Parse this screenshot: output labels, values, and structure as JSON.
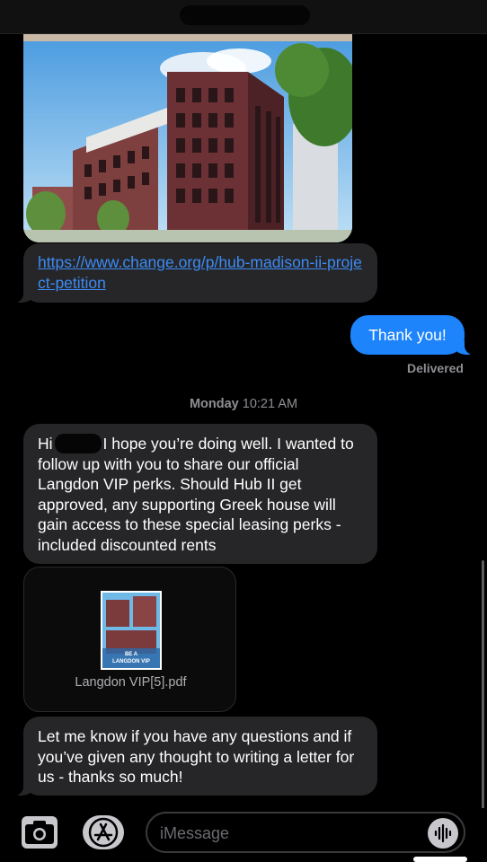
{
  "thread": {
    "messages": [
      {
        "type": "image",
        "sender": "contact"
      },
      {
        "type": "link",
        "sender": "contact",
        "text": "https://www.change.org/p/hub-madison-ii-project-petition"
      },
      {
        "type": "text",
        "sender": "me",
        "text": "Thank you!",
        "status": "Delivered"
      }
    ],
    "timestamp": {
      "day": "Monday",
      "time": "10:21 AM"
    },
    "message_1": {
      "greeting": "Hi",
      "body": "I hope you’re doing well. I wanted to follow up with you to share our official Langdon VIP perks. Should Hub II get approved, any supporting Greek house will gain access to these special leasing perks - included discounted rents"
    },
    "attachment": {
      "filename": "Langdon VIP[5].pdf",
      "thumbnail_caption": "BE A LANGDON VIP"
    },
    "message_2": {
      "text": "Let me know if you have any questions and if you’ve given any thought to writing a letter for us - thanks so much!"
    }
  },
  "composer": {
    "placeholder": "iMessage",
    "camera_icon": "camera-icon",
    "apps_icon": "app-store-icon",
    "voice_icon": "audio-waveform-icon"
  },
  "colors": {
    "outgoing_bubble": "#1d84fb",
    "incoming_bubble": "#262628",
    "link": "#3c8bf5",
    "meta_text": "#8e8e93"
  }
}
